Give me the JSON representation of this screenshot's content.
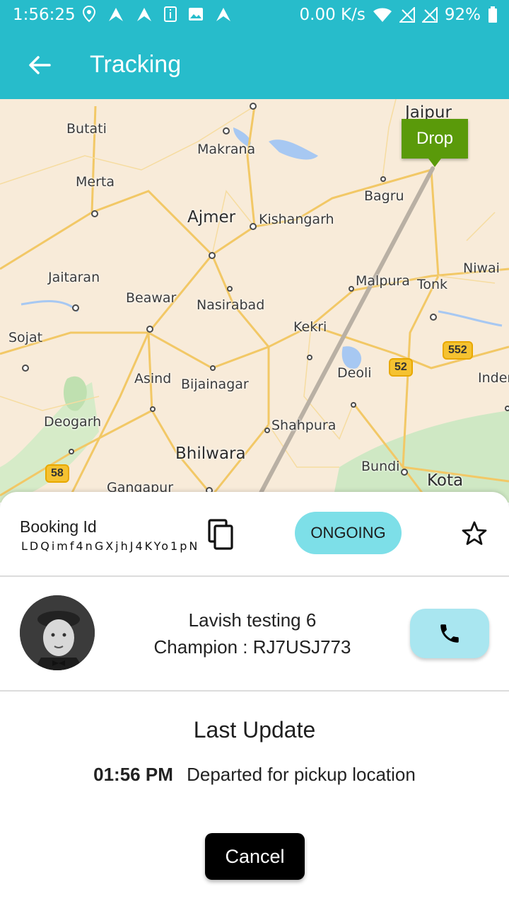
{
  "status_bar": {
    "time": "1:56:25",
    "network_speed": "0.00 K/s",
    "battery": "92%"
  },
  "app_bar": {
    "title": "Tracking"
  },
  "map": {
    "drop_label": "Drop",
    "cities": [
      "Jaipur",
      "Butati",
      "Makrana",
      "Merta",
      "Ajmer",
      "Kishangarh",
      "Bagru",
      "Niwai",
      "Jaitaran",
      "Beawar",
      "Nasirabad",
      "Malpura",
      "Tonk",
      "Sojat",
      "Kekri",
      "Deoli",
      "Inder",
      "Asind",
      "Bijainagar",
      "Deogarh",
      "Shahpura",
      "Bhilwara",
      "Bundi",
      "Kota",
      "Gangapur"
    ],
    "highway_shields": [
      "552",
      "52",
      "58"
    ]
  },
  "booking": {
    "label": "Booking Id",
    "id": "LDQimf4nGXjhJ4KYo1pN",
    "status": "ONGOING"
  },
  "driver": {
    "name": "Lavish testing 6",
    "champion": "Champion : RJ7USJ773"
  },
  "last_update": {
    "title": "Last Update",
    "time": "01:56 PM",
    "message": "Departed for pickup location"
  },
  "actions": {
    "cancel_label": "Cancel"
  }
}
